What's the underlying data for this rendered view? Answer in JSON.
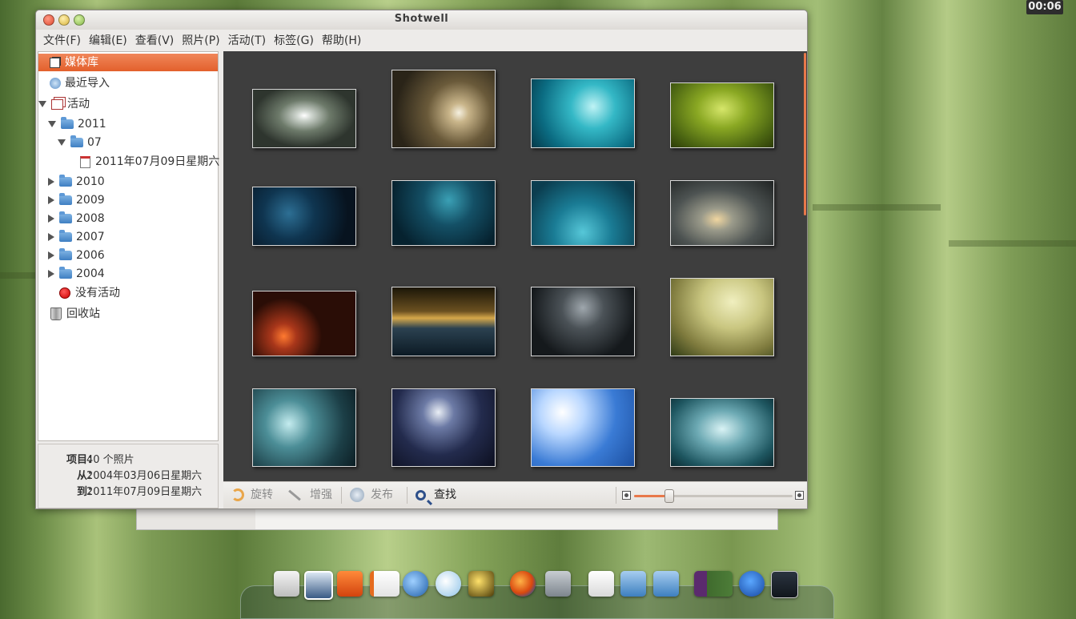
{
  "clock": "00:06",
  "window": {
    "title": "Shotwell"
  },
  "menu": [
    "文件(F)",
    "编辑(E)",
    "查看(V)",
    "照片(P)",
    "活动(T)",
    "标签(G)",
    "帮助(H)"
  ],
  "sidebar": {
    "library": "媒体库",
    "recent": "最近导入",
    "events": "活动",
    "year_2011": "2011",
    "month_07": "07",
    "day": "2011年07月09日星期六",
    "year_2010": "2010",
    "year_2009": "2009",
    "year_2008": "2008",
    "year_2007": "2007",
    "year_2006": "2006",
    "year_2004": "2004",
    "no_event": "没有活动",
    "trash": "回收站"
  },
  "info": {
    "items_label": "项目：",
    "items_value": "40 个照片",
    "from_label": "从：",
    "from_value": "2004年03月06日星期六",
    "to_label": "到：",
    "to_value": "2011年07月09日星期六"
  },
  "toolbar": {
    "rotate": "旋转",
    "enhance": "增强",
    "publish": "发布",
    "find": "查找",
    "zoom_level": 0.22
  },
  "colors": {
    "accent": "#e8784a",
    "viewer_bg": "#3e3e3e",
    "selected_row": "#e3602c"
  },
  "dock_icons": [
    "files-icon",
    "photo-viewer-icon",
    "shopping-bag-icon",
    "presentation-icon",
    "thunderbird-icon",
    "messenger-icon",
    "wallpaper-icon",
    "firefox-icon",
    "calculator-icon",
    "text-editor-icon",
    "timeline-folder-icon",
    "downloads-folder-icon",
    "workspace-switcher-icon",
    "accessibility-icon",
    "desktop-icon"
  ]
}
